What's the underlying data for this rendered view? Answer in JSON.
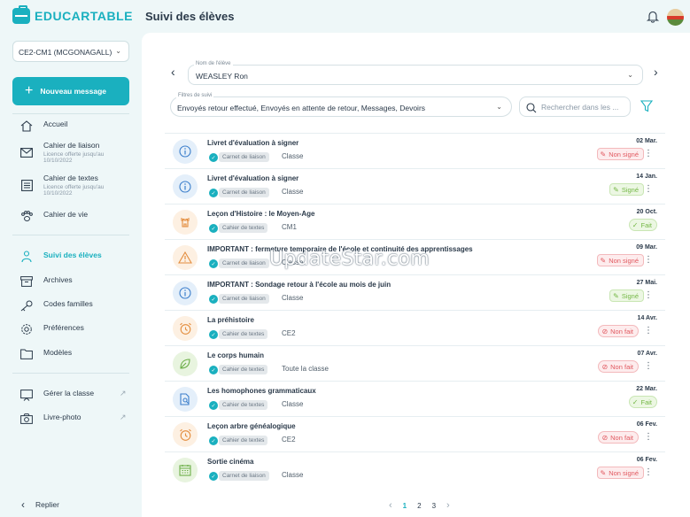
{
  "app": {
    "logo_edu": "EDU",
    "logo_cartable": "CARTABLE",
    "page_title": "Suivi des élèves"
  },
  "sidebar": {
    "class_select": "CE2-CM1 (MCGONAGALL)",
    "new_message": "Nouveau message",
    "items": [
      {
        "label": "Accueil",
        "sub": ""
      },
      {
        "label": "Cahier de liaison",
        "sub": "Licence offerte jusqu'au 10/10/2022"
      },
      {
        "label": "Cahier de textes",
        "sub": "Licence offerte jusqu'au 10/10/2022"
      },
      {
        "label": "Cahier de vie",
        "sub": ""
      },
      {
        "label": "Suivi des élèves",
        "sub": ""
      },
      {
        "label": "Archives",
        "sub": ""
      },
      {
        "label": "Codes familles",
        "sub": ""
      },
      {
        "label": "Préférences",
        "sub": ""
      },
      {
        "label": "Modèles",
        "sub": ""
      },
      {
        "label": "Gérer la classe",
        "sub": ""
      },
      {
        "label": "Livre-photo",
        "sub": ""
      }
    ],
    "back": "Replier"
  },
  "student": {
    "label": "Nom de l'élève",
    "value": "WEASLEY Ron"
  },
  "filters": {
    "label": "Filtres de suivi",
    "value": "Envoyés retour effectué, Envoyés en attente de retour, Messages, Devoirs"
  },
  "search": {
    "placeholder": "Rechercher dans les ..."
  },
  "rows": [
    {
      "title": "Livret d'évaluation à signer",
      "tag": "Carnet de liaison",
      "target": "Classe",
      "date": "02 Mar.",
      "status": "Non signé",
      "kind": "info"
    },
    {
      "title": "Livret d'évaluation à signer",
      "tag": "Carnet de liaison",
      "target": "Classe",
      "date": "14 Jan.",
      "status": "Signé",
      "kind": "info"
    },
    {
      "title": "Leçon d'Histoire : le Moyen-Age",
      "tag": "Cahier de textes",
      "target": "CM1",
      "date": "20 Oct.",
      "status": "Fait",
      "kind": "castle"
    },
    {
      "title": "IMPORTANT : fermeture temporaire de l'école et continuité des apprentissages",
      "tag": "Carnet de liaison",
      "target": "Classe",
      "date": "09 Mar.",
      "status": "Non signé",
      "kind": "warning"
    },
    {
      "title": "IMPORTANT : Sondage retour à l'école au mois de juin",
      "tag": "Carnet de liaison",
      "target": "Classe",
      "date": "27 Mai.",
      "status": "Signé",
      "kind": "info"
    },
    {
      "title": "La préhistoire",
      "tag": "Cahier de textes",
      "target": "CE2",
      "date": "14 Avr.",
      "status": "Non fait",
      "kind": "clock"
    },
    {
      "title": "Le corps humain",
      "tag": "Cahier de textes",
      "target": "Toute la classe",
      "date": "07 Avr.",
      "status": "Non fait",
      "kind": "leaf"
    },
    {
      "title": "Les homophones grammaticaux",
      "tag": "Cahier de textes",
      "target": "Classe",
      "date": "22 Mar.",
      "status": "Fait",
      "kind": "doc"
    },
    {
      "title": "Leçon arbre généalogique",
      "tag": "Cahier de textes",
      "target": "CE2",
      "date": "06 Fev.",
      "status": "Non fait",
      "kind": "clock"
    },
    {
      "title": "Sortie cinéma",
      "tag": "Carnet de liaison",
      "target": "Classe",
      "date": "06 Fev.",
      "status": "Non signé",
      "kind": "calendar"
    }
  ],
  "pagination": {
    "pages": [
      "1",
      "2",
      "3"
    ],
    "current": "1"
  },
  "watermark": "UpdateStar.com",
  "colors": {
    "accent": "#1ab0bf",
    "red": "#e15960",
    "green": "#74b745",
    "orange": "#f0a050"
  }
}
